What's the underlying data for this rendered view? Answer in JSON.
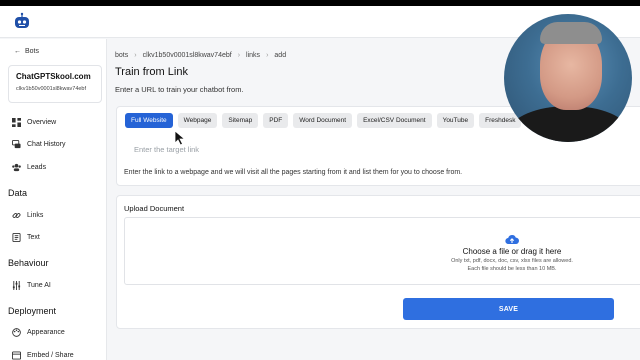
{
  "sidebar": {
    "back_label": "Bots",
    "bot_name": "ChatGPTSkool.com",
    "bot_id": "clkv1b50v0001sl8kwav74ebf",
    "nav_top": [
      {
        "label": "Overview",
        "icon": "dashboard-icon"
      },
      {
        "label": "Chat History",
        "icon": "chat-history-icon"
      },
      {
        "label": "Leads",
        "icon": "leads-icon"
      }
    ],
    "section_data": "Data",
    "nav_data": [
      {
        "label": "Links",
        "icon": "link-icon"
      },
      {
        "label": "Text",
        "icon": "text-icon"
      }
    ],
    "section_behaviour": "Behaviour",
    "nav_behaviour": [
      {
        "label": "Tune AI",
        "icon": "sliders-icon"
      }
    ],
    "section_deployment": "Deployment",
    "nav_deployment": [
      {
        "label": "Appearance",
        "icon": "palette-icon"
      },
      {
        "label": "Embed / Share",
        "icon": "embed-icon"
      }
    ]
  },
  "breadcrumb": [
    "bots",
    "clkv1b50v0001sl8kwav74ebf",
    "links",
    "add"
  ],
  "main": {
    "title": "Train from Link",
    "subtitle": "Enter a URL to train your chatbot from."
  },
  "tabs": [
    "Full Website",
    "Webpage",
    "Sitemap",
    "PDF",
    "Word Document",
    "Excel/CSV Document",
    "YouTube",
    "Freshdesk"
  ],
  "active_tab": "Full Website",
  "target_input": {
    "value": "",
    "placeholder": "Enter the target link"
  },
  "hint": "Enter the link to a webpage and we will visit all the pages starting from it and list them for you to choose from.",
  "upload": {
    "label": "Upload Document",
    "choose_text": "Choose a file or drag it here",
    "allowed_text": "Only txt, pdf, docx, doc, csv, xlsx files are allowed.",
    "size_text": "Each file should be less than 10 MB."
  },
  "save_label": "SAVE",
  "colors": {
    "accent": "#2563d6",
    "save": "#2f6fe0"
  }
}
